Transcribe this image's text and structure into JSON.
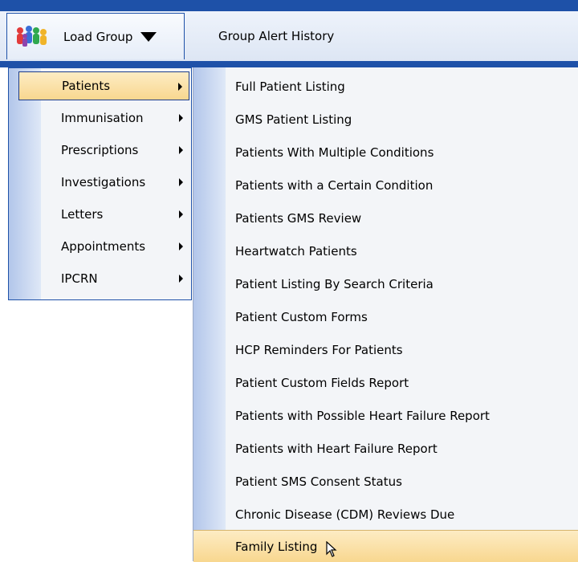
{
  "menubar": {
    "load_group_label": "Load Group",
    "group_alert_history_label": "Group Alert History"
  },
  "menu1": {
    "items": [
      {
        "label": "Patients"
      },
      {
        "label": "Immunisation"
      },
      {
        "label": "Prescriptions"
      },
      {
        "label": "Investigations"
      },
      {
        "label": "Letters"
      },
      {
        "label": "Appointments"
      },
      {
        "label": "IPCRN"
      }
    ]
  },
  "menu2": {
    "items": [
      {
        "label": "Full Patient Listing"
      },
      {
        "label": "GMS Patient Listing"
      },
      {
        "label": "Patients With Multiple Conditions"
      },
      {
        "label": "Patients with a Certain Condition"
      },
      {
        "label": "Patients GMS Review"
      },
      {
        "label": "Heartwatch Patients"
      },
      {
        "label": "Patient Listing By Search Criteria"
      },
      {
        "label": "Patient Custom Forms"
      },
      {
        "label": "HCP Reminders For Patients"
      },
      {
        "label": "Patient Custom Fields Report"
      },
      {
        "label": "Patients with Possible Heart Failure Report"
      },
      {
        "label": "Patients with Heart Failure Report"
      },
      {
        "label": "Patient SMS Consent Status"
      },
      {
        "label": "Chronic Disease (CDM) Reviews Due"
      },
      {
        "label": "Family Listing"
      }
    ]
  },
  "colors": {
    "accent": "#1e51a8",
    "highlight": "#f8d78f"
  }
}
